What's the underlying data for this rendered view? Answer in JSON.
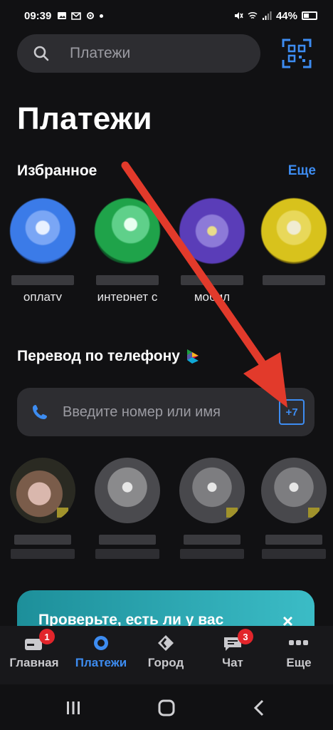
{
  "status": {
    "time": "09:39",
    "battery": "44%"
  },
  "search": {
    "label": "Платежи"
  },
  "title": "Платежи",
  "favorites": {
    "header": "Избранное",
    "more": "Еще",
    "items": [
      {
        "label": "оплату",
        "color": "#3b7be8"
      },
      {
        "label": "интернет с",
        "color": "#1fa34a"
      },
      {
        "label": "мобил",
        "color": "#5a3db8"
      },
      {
        "label": "",
        "color": "#d8c21c"
      }
    ]
  },
  "phone_transfer": {
    "header": "Перевод по телефону",
    "placeholder": "Введите номер или имя",
    "prefix": "+7"
  },
  "banner": {
    "text": "Проверьте, есть ли у вас",
    "close": "×"
  },
  "tabs": [
    {
      "label": "Главная",
      "icon": "card-icon",
      "badge": "1"
    },
    {
      "label": "Платежи",
      "icon": "payments-icon",
      "badge": ""
    },
    {
      "label": "Город",
      "icon": "city-icon",
      "badge": ""
    },
    {
      "label": "Чат",
      "icon": "chat-icon",
      "badge": "3"
    },
    {
      "label": "Еще",
      "icon": "more-icon",
      "badge": ""
    }
  ]
}
